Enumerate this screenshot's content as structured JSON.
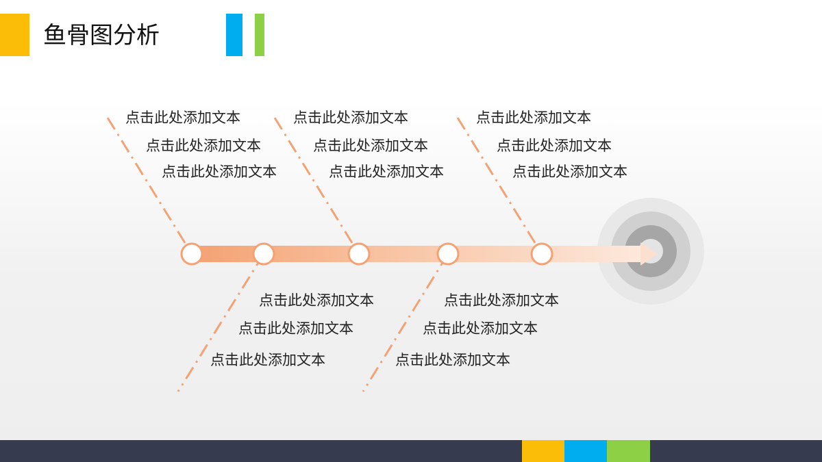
{
  "title": "鱼骨图分析",
  "colors": {
    "accent_yellow": "#fbbd07",
    "accent_blue": "#00aeef",
    "accent_green": "#8dcf45",
    "spine": "#f4a273",
    "footer": "#373b4f",
    "target_outer": "#e7e7e7",
    "target_mid": "#cfcfcf",
    "target_inner": "#a5a5a5"
  },
  "branches": {
    "top": [
      {
        "labels": [
          "点击此处添加文本",
          "点击此处添加文本",
          "点击此处添加文本"
        ]
      },
      {
        "labels": [
          "点击此处添加文本",
          "点击此处添加文本",
          "点击此处添加文本"
        ]
      },
      {
        "labels": [
          "点击此处添加文本",
          "点击此处添加文本",
          "点击此处添加文本"
        ]
      }
    ],
    "bottom": [
      {
        "labels": [
          "点击此处添加文本",
          "点击此处添加文本",
          "点击此处添加文本"
        ]
      },
      {
        "labels": [
          "点击此处添加文本",
          "点击此处添加文本",
          "点击此处添加文本"
        ]
      }
    ]
  }
}
